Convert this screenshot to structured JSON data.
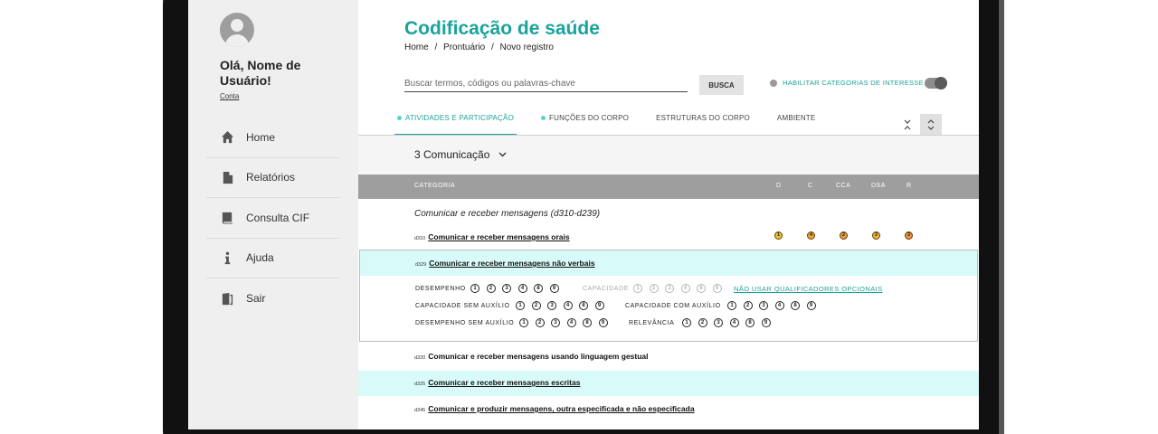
{
  "sidebar": {
    "greeting": "Olá, Nome de Usuário!",
    "account_link": "Conta",
    "items": [
      {
        "label": "Home",
        "icon": "home-icon"
      },
      {
        "label": "Relatórios",
        "icon": "document-icon"
      },
      {
        "label": "Consulta CIF",
        "icon": "book-icon"
      },
      {
        "label": "Ajuda",
        "icon": "info-icon"
      },
      {
        "label": "Sair",
        "icon": "exit-icon"
      }
    ]
  },
  "header": {
    "title": "Codificação de saúde",
    "breadcrumb": [
      "Home",
      "/",
      "Prontuário",
      "/",
      "Novo registro"
    ]
  },
  "search": {
    "placeholder": "Buscar termos, códigos ou palavras-chave",
    "button_label": "BUSCA",
    "interest_label": "HABILITAR CATEGORIAS DE INTERESSE",
    "interest_enabled": true
  },
  "tabs": [
    {
      "label": "ATIVIDADES E PARTICIPAÇÃO",
      "active": true,
      "marked": true
    },
    {
      "label": "FUNÇÕES DO CORPO",
      "active": false,
      "marked": true
    },
    {
      "label": "ESTRUTURAS DO CORPO",
      "active": false,
      "marked": false
    },
    {
      "label": "AMBIENTE",
      "active": false,
      "marked": false
    }
  ],
  "section": {
    "title": "3 Comunicação"
  },
  "table": {
    "headers": [
      "CATEGORIA",
      "D",
      "C",
      "CCA",
      "DSA",
      "R"
    ],
    "group_title": "Comunicar e receber mensagens (d310-d239)",
    "rows": [
      {
        "code": "d310",
        "label": "Comunicar e receber mensagens orais",
        "badges": [
          "1",
          "4",
          "2",
          "2",
          "3"
        ],
        "badge_colors": [
          "#f2c12e",
          "#f0a23a",
          "#f09a3f",
          "#f2b33a",
          "#f08f45"
        ]
      },
      {
        "code": "d320",
        "label": "Comunicar e receber mensagens usando linguagem gestual"
      },
      {
        "code": "d325",
        "label": "Comunicar e receber mensagens escritas"
      },
      {
        "code": "d345",
        "label": "Comunicar e produzir mensagens, outra especificada e não especificada"
      }
    ],
    "expanded_row": {
      "code": "d329",
      "label": "Comunicar e receber mensagens não verbais",
      "qualifiers": {
        "desempenho": "DESEMPENHO",
        "capacidade": "CAPACIDADE",
        "optional_link": "NÃO USAR QUALIFICADORES OPCIONAIS",
        "capacidade_sem": "CAPACIDADE SEM AUXÍLIO",
        "capacidade_com": "CAPACIDADE COM AUXÍLIO",
        "desempenho_sem": "DESEMPENHO SEM AUXÍLIO",
        "relevancia": "RELEVÂNCIA"
      },
      "options": [
        "1",
        "2",
        "3",
        "4",
        "8",
        "9"
      ]
    }
  },
  "colors": {
    "accent": "#1aa39b",
    "highlight": "#d8fbfa",
    "table_header": "#9e9e9e"
  }
}
